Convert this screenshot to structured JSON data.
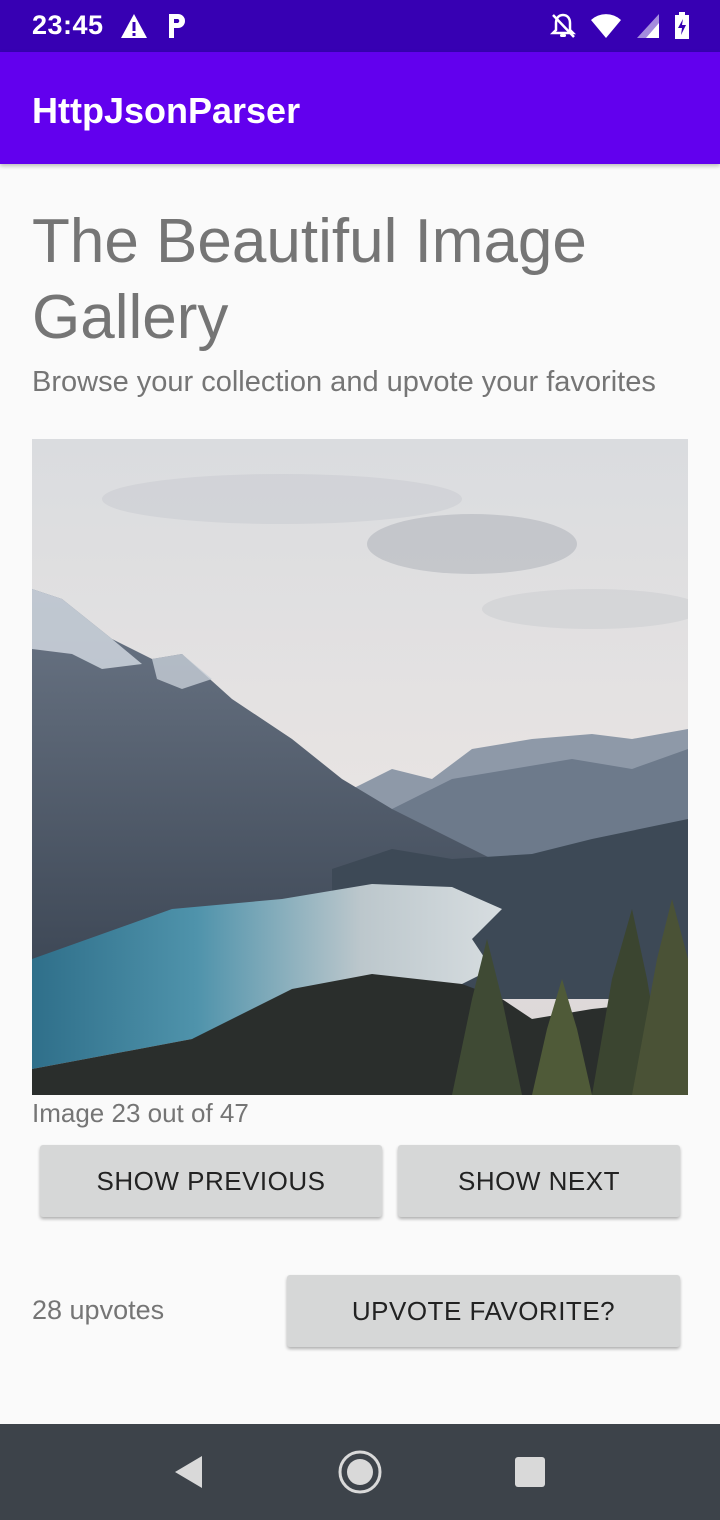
{
  "status_bar": {
    "time": "23:45",
    "left_icons": [
      "warning-icon",
      "parking-icon"
    ],
    "right_icons": [
      "notifications-off-icon",
      "wifi-icon",
      "signal-icon",
      "battery-charging-icon"
    ]
  },
  "app_bar": {
    "title": "HttpJsonParser",
    "color": "#6200ee"
  },
  "gallery": {
    "title": "The Beautiful Image Gallery",
    "subtitle": "Browse your collection and upvote your favorites",
    "counter": "Image 23 out of 47",
    "show_previous_label": "SHOW PREVIOUS",
    "show_next_label": "SHOW NEXT",
    "upvotes": "28 upvotes",
    "upvote_label": "UPVOTE FAVORITE?"
  },
  "nav_bar": {
    "icons": [
      "back-icon",
      "home-icon",
      "recents-icon"
    ]
  },
  "colors": {
    "status_bar": "#3700b3",
    "accent": "#6200ee",
    "button": "#d6d7d7",
    "text_secondary": "#757575"
  }
}
